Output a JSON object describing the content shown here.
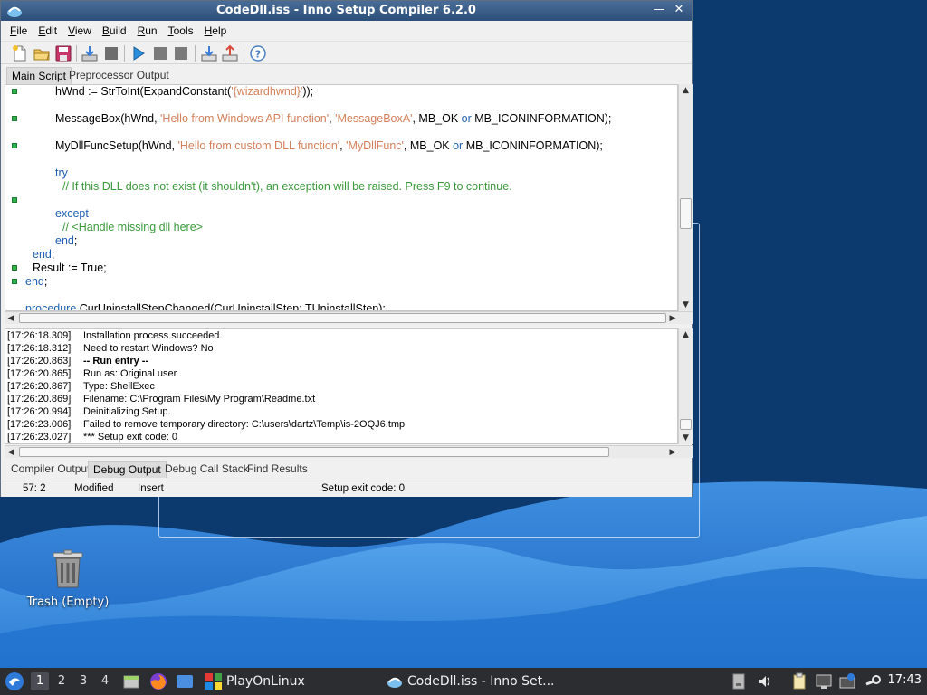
{
  "window": {
    "title": "CodeDll.iss - Inno Setup Compiler 6.2.0",
    "close_glyph": "✕",
    "minimize_glyph": "—"
  },
  "menu": [
    {
      "label": "File",
      "key": "F",
      "rest": "ile"
    },
    {
      "label": "Edit",
      "key": "E",
      "rest": "dit"
    },
    {
      "label": "View",
      "key": "V",
      "rest": "iew"
    },
    {
      "label": "Build",
      "key": "B",
      "rest": "uild"
    },
    {
      "label": "Run",
      "key": "R",
      "rest": "un"
    },
    {
      "label": "Tools",
      "key": "T",
      "rest": "ools"
    },
    {
      "label": "Help",
      "key": "H",
      "rest": "elp"
    }
  ],
  "top_tabs": [
    "Main Script",
    "Preprocessor Output"
  ],
  "editor_lines": [
    {
      "marker": true,
      "segments": [
        {
          "t": "hWnd := StrToInt(ExpandConstant(",
          "c": ""
        },
        {
          "t": "'{wizardhwnd}'",
          "c": "str"
        },
        {
          "t": "));",
          "c": ""
        }
      ],
      "indent": 2
    },
    {
      "marker": false,
      "segments": [],
      "indent": 0
    },
    {
      "marker": true,
      "segments": [
        {
          "t": "MessageBox(hWnd, ",
          "c": ""
        },
        {
          "t": "'Hello from Windows API function'",
          "c": "str"
        },
        {
          "t": ", ",
          "c": ""
        },
        {
          "t": "'MessageBoxA'",
          "c": "str"
        },
        {
          "t": ", MB_OK ",
          "c": ""
        },
        {
          "t": "or",
          "c": "kw"
        },
        {
          "t": " MB_ICONINFORMATION);",
          "c": ""
        }
      ],
      "indent": 2
    },
    {
      "marker": false,
      "segments": [],
      "indent": 0
    },
    {
      "marker": true,
      "segments": [
        {
          "t": "MyDllFuncSetup(hWnd, ",
          "c": ""
        },
        {
          "t": "'Hello from custom DLL function'",
          "c": "str"
        },
        {
          "t": ", ",
          "c": ""
        },
        {
          "t": "'MyDllFunc'",
          "c": "str"
        },
        {
          "t": ", MB_OK ",
          "c": ""
        },
        {
          "t": "or",
          "c": "kw"
        },
        {
          "t": " MB_ICONINFORMATION);",
          "c": ""
        }
      ],
      "indent": 2
    },
    {
      "marker": false,
      "segments": [],
      "indent": 0
    },
    {
      "marker": false,
      "segments": [
        {
          "t": "try",
          "c": "kw"
        }
      ],
      "indent": 2
    },
    {
      "marker": false,
      "segments": [
        {
          "t": "// If this DLL does not exist (it shouldn't), an exception will be raised. Press F9 to continue.",
          "c": "cmt"
        }
      ],
      "indent": 3
    },
    {
      "marker": true,
      "segments": [],
      "indent": 0
    },
    {
      "marker": false,
      "segments": [
        {
          "t": "except",
          "c": "kw"
        }
      ],
      "indent": 2
    },
    {
      "marker": false,
      "segments": [
        {
          "t": "// <Handle missing dll here>",
          "c": "cmt"
        }
      ],
      "indent": 3
    },
    {
      "marker": false,
      "segments": [
        {
          "t": "end",
          "c": "kw"
        },
        {
          "t": ";",
          "c": ""
        }
      ],
      "indent": 2
    },
    {
      "marker": false,
      "segments": [
        {
          "t": "end",
          "c": "kw"
        },
        {
          "t": ";",
          "c": ""
        }
      ],
      "indent": 1
    },
    {
      "marker": true,
      "segments": [
        {
          "t": "Result := True;",
          "c": ""
        }
      ],
      "indent": 1
    },
    {
      "marker": true,
      "segments": [
        {
          "t": "end",
          "c": "kw"
        },
        {
          "t": ";",
          "c": ""
        }
      ],
      "indent": 0
    },
    {
      "marker": false,
      "segments": [],
      "indent": 0
    },
    {
      "marker": false,
      "segments": [
        {
          "t": "procedure",
          "c": "kw"
        },
        {
          "t": " CurUninstallStepChanged(CurUninstallStep: TUninstallStep);",
          "c": ""
        }
      ],
      "indent": 0
    }
  ],
  "output_lines": [
    {
      "ts": "[17:26:18.309]",
      "msg": "Installation process succeeded.",
      "bold": false
    },
    {
      "ts": "[17:26:18.312]",
      "msg": "Need to restart Windows? No",
      "bold": false
    },
    {
      "ts": "[17:26:20.863]",
      "msg": "-- Run entry --",
      "bold": true
    },
    {
      "ts": "[17:26:20.865]",
      "msg": "Run as: Original user",
      "bold": false
    },
    {
      "ts": "[17:26:20.867]",
      "msg": "Type: ShellExec",
      "bold": false
    },
    {
      "ts": "[17:26:20.869]",
      "msg": "Filename: C:\\Program Files\\My Program\\Readme.txt",
      "bold": false
    },
    {
      "ts": "[17:26:20.994]",
      "msg": "Deinitializing Setup.",
      "bold": false
    },
    {
      "ts": "[17:26:23.006]",
      "msg": "Failed to remove temporary directory: C:\\users\\dartz\\Temp\\is-2OQJ6.tmp",
      "bold": false
    },
    {
      "ts": "[17:26:23.027]",
      "msg": "*** Setup exit code: 0",
      "bold": false
    }
  ],
  "bottom_tabs": [
    "Compiler Output",
    "Debug Output",
    "Debug Call Stack",
    "Find Results"
  ],
  "bottom_active": 1,
  "status": {
    "position": "57:  2",
    "modified": "Modified",
    "mode": "Insert",
    "message": "Setup exit code: 0"
  },
  "desktop": {
    "trash_label": "Trash (Empty)"
  },
  "taskbar": {
    "workspaces": [
      "1",
      "2",
      "3",
      "4"
    ],
    "active_workspace": 0,
    "playonlinux_label": "PlayOnLinux",
    "task_label": "CodeDll.iss - Inno Set...",
    "clock": "17:43"
  },
  "colors": {
    "title_bar": "#2c4f79",
    "keyword": "#1f5fb3",
    "string": "#d4805a",
    "comment": "#3a9a3a",
    "marker": "#2db34a",
    "taskbar": "#2b2d31"
  }
}
